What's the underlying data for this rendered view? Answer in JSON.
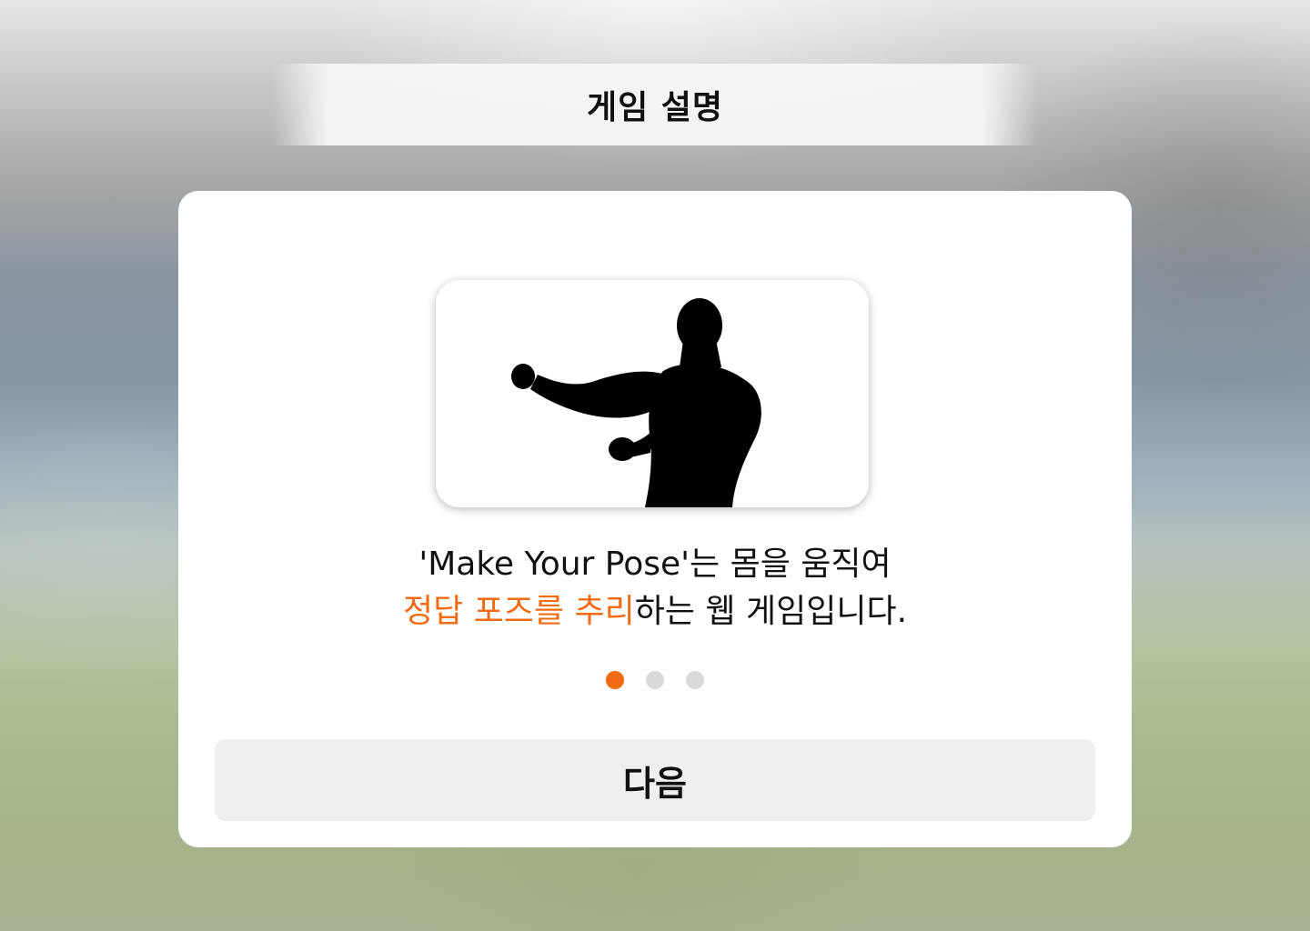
{
  "header": {
    "title": "게임 설명"
  },
  "modal": {
    "illustration": "pose-silhouette",
    "description": {
      "line1": "'Make Your Pose'는 몸을 움직여",
      "line2_highlight": "정답 포즈를 추리",
      "line2_rest": "하는 웹 게임입니다."
    },
    "pagination": {
      "total": 3,
      "current": 1
    },
    "next_button_label": "다음"
  },
  "colors": {
    "accent": "#f26b12",
    "dot_inactive": "#d9d9d9",
    "button_bg": "#efefef",
    "card_bg": "#ffffff"
  }
}
